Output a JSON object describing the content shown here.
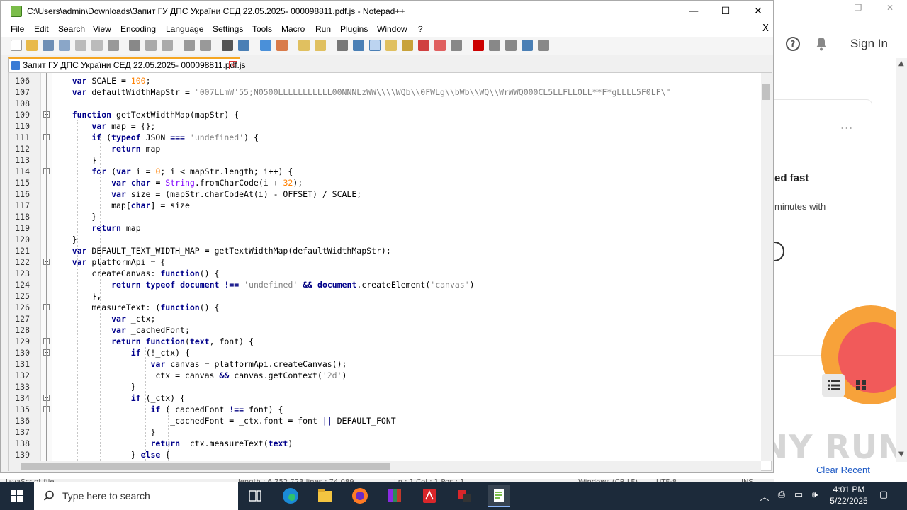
{
  "window": {
    "title": "C:\\Users\\admin\\Downloads\\Запит ГУ ДПС України СЕД 22.05.2025- 000098811.pdf.js - Notepad++",
    "minimize": "—",
    "maximize": "☐",
    "close": "✕"
  },
  "menu": {
    "items": [
      "File",
      "Edit",
      "Search",
      "View",
      "Encoding",
      "Language",
      "Settings",
      "Tools",
      "Macro",
      "Run",
      "Plugins",
      "Window",
      "?"
    ],
    "close": "X"
  },
  "tab": {
    "title": "Запит ГУ ДПС України СЕД 22.05.2025- 000098811.pdf.js",
    "close": "x"
  },
  "editor": {
    "line_numbers": [
      "106",
      "107",
      "108",
      "109",
      "110",
      "111",
      "112",
      "113",
      "114",
      "115",
      "116",
      "117",
      "118",
      "119",
      "120",
      "121",
      "122",
      "123",
      "124",
      "125",
      "126",
      "127",
      "128",
      "129",
      "130",
      "131",
      "132",
      "133",
      "134",
      "135",
      "136",
      "137",
      "138",
      "139"
    ]
  },
  "status": {
    "type": "JavaScript file",
    "length": "length : 6,752,723   lines : 74,089",
    "pos": "Ln : 1    Col : 1    Pos : 1",
    "eol": "Windows (CR LF)",
    "enc": "UTF-8",
    "ins": "INS"
  },
  "side_window": {
    "sign_in": "Sign In",
    "help": "?",
    "more": "···",
    "heading_fragment": "ed fast",
    "sub_fragment": "minutes with",
    "clear_recent": "Clear Recent",
    "watermark": "ANY RUN",
    "min": "—",
    "max": "❐",
    "close": "✕"
  },
  "taskbar": {
    "search_placeholder": "Type here to search",
    "time": "4:01 PM",
    "date": "5/22/2025"
  }
}
